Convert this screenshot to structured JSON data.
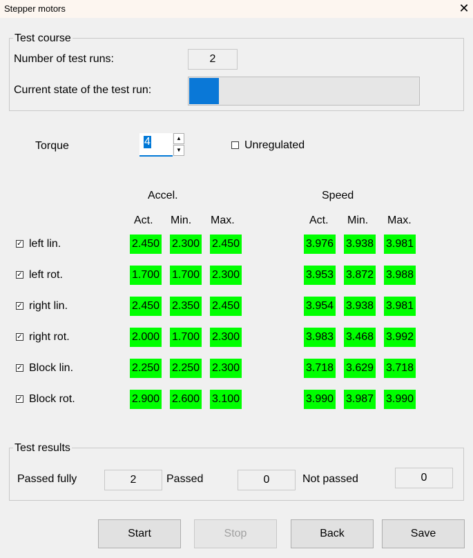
{
  "window": {
    "title": "Stepper motors",
    "close_glyph": "✕"
  },
  "test_course": {
    "legend": "Test course",
    "runs_label": "Number of test runs:",
    "runs_value": "2",
    "state_label": "Current state of the test run:",
    "progress_fraction": 0.13
  },
  "torque": {
    "label": "Torque",
    "value": "4",
    "up_glyph": "▲",
    "down_glyph": "▼",
    "unregulated_label": "Unregulated",
    "unregulated_checked": false
  },
  "headers": {
    "accel": "Accel.",
    "speed": "Speed",
    "act": "Act.",
    "min": "Min.",
    "max": "Max."
  },
  "rows": [
    {
      "label": "left lin.",
      "checked": true,
      "accel": [
        "2.450",
        "2.300",
        "2.450"
      ],
      "speed": [
        "3.976",
        "3.938",
        "3.981"
      ]
    },
    {
      "label": "left rot.",
      "checked": true,
      "accel": [
        "1.700",
        "1.700",
        "2.300"
      ],
      "speed": [
        "3.953",
        "3.872",
        "3.988"
      ]
    },
    {
      "label": "right lin.",
      "checked": true,
      "accel": [
        "2.450",
        "2.350",
        "2.450"
      ],
      "speed": [
        "3.954",
        "3.938",
        "3.981"
      ]
    },
    {
      "label": "right rot.",
      "checked": true,
      "accel": [
        "2.000",
        "1.700",
        "2.300"
      ],
      "speed": [
        "3.983",
        "3.468",
        "3.992"
      ]
    },
    {
      "label": "Block lin.",
      "checked": true,
      "accel": [
        "2.250",
        "2.250",
        "2.300"
      ],
      "speed": [
        "3.718",
        "3.629",
        "3.718"
      ]
    },
    {
      "label": "Block rot.",
      "checked": true,
      "accel": [
        "2.900",
        "2.600",
        "3.100"
      ],
      "speed": [
        "3.990",
        "3.987",
        "3.990"
      ]
    }
  ],
  "check_glyph": "✓",
  "results": {
    "legend": "Test results",
    "passed_fully_label": "Passed fully",
    "passed_fully_value": "2",
    "passed_label": "Passed",
    "passed_value": "0",
    "not_passed_label": "Not passed",
    "not_passed_value": "0"
  },
  "buttons": {
    "start": "Start",
    "stop": "Stop",
    "back": "Back",
    "save": "Save"
  },
  "colors": {
    "cell_pass": "#00ff00",
    "accent": "#0078d7",
    "progress": "#0a78d7"
  }
}
